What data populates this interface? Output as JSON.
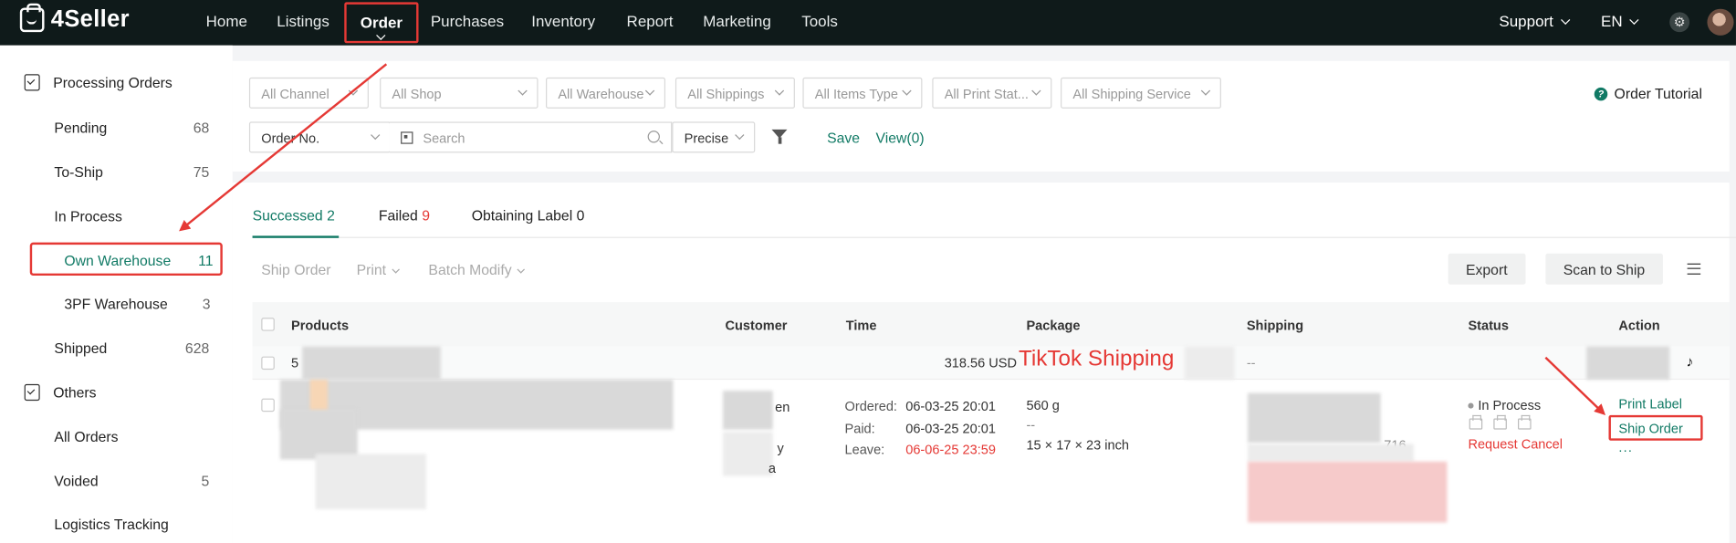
{
  "app": {
    "logo_text": "4Seller"
  },
  "topnav": {
    "items": [
      "Home",
      "Listings",
      "Order",
      "Purchases",
      "Inventory",
      "Report",
      "Marketing",
      "Tools"
    ],
    "support": "Support",
    "lang": "EN"
  },
  "sidebar": {
    "processing_title": "Processing Orders",
    "pending": {
      "label": "Pending",
      "count": "68"
    },
    "to_ship": {
      "label": "To-Ship",
      "count": "75"
    },
    "in_process": {
      "label": "In Process"
    },
    "own_warehouse": {
      "label": "Own Warehouse",
      "count": "11"
    },
    "threepf": {
      "label": "3PF Warehouse",
      "count": "3"
    },
    "shipped": {
      "label": "Shipped",
      "count": "628"
    },
    "others_title": "Others",
    "all_orders": {
      "label": "All Orders"
    },
    "voided": {
      "label": "Voided",
      "count": "5"
    },
    "logistics": {
      "label": "Logistics Tracking"
    }
  },
  "filters": {
    "channel": "All Channel",
    "shop": "All Shop",
    "warehouse": "All Warehouse",
    "shippings": "All Shippings",
    "items_type": "All Items Type",
    "print_status": "All Print Stat...",
    "shipping_service": "All Shipping Service",
    "search_field": "Order No.",
    "search_placeholder": "Search",
    "match_mode": "Precise",
    "save_label": "Save",
    "view_label": "View(0)",
    "tutorial": "Order Tutorial"
  },
  "tabs": {
    "successed": "Successed 2",
    "failed_label": "Failed",
    "failed_count": "9",
    "obtaining": "Obtaining Label 0"
  },
  "toolbar": {
    "ship_order": "Ship Order",
    "print": "Print",
    "batch_modify": "Batch Modify",
    "export": "Export",
    "scan_to_ship": "Scan to Ship"
  },
  "table": {
    "headers": [
      "Products",
      "Customer",
      "Time",
      "Package",
      "Shipping",
      "Status",
      "Action"
    ],
    "order": {
      "id_prefix": "5",
      "amount": "318.56 USD",
      "annotation": "TikTok Shipping",
      "shipping_dash": "--",
      "platform_icon": "tiktok-icon",
      "customer_fragments": [
        "en",
        "y",
        "a"
      ],
      "time": {
        "ordered_label": "Ordered:",
        "ordered": "06-03-25 20:01",
        "paid_label": "Paid:",
        "paid": "06-03-25 20:01",
        "leave_label": "Leave:",
        "leave": "06-06-25 23:59"
      },
      "package": {
        "weight": "560 g",
        "dash": "--",
        "dims": "15 × 17 × 23 inch"
      },
      "shipping_fragment": "716",
      "status": "In Process",
      "request_cancel": "Request Cancel",
      "actions": {
        "print_label": "Print Label",
        "ship_order": "Ship Order",
        "more": "..."
      }
    }
  }
}
